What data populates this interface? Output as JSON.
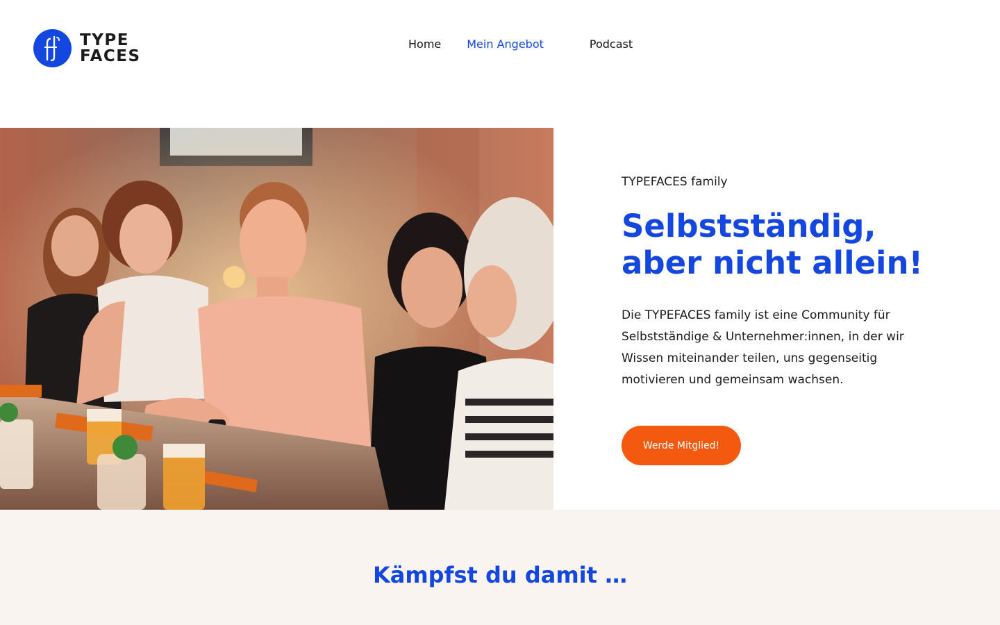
{
  "header": {
    "logo": {
      "line1": "TYPE",
      "line2": "FACES"
    },
    "nav": {
      "home": "Home",
      "angebot": "Mein Angebot",
      "angebot_caret": "",
      "podcast_icon": "",
      "podcast": "Podcast"
    }
  },
  "hero": {
    "image_alt": "Gruppe von Menschen an einem Tisch in einer Bar",
    "eyebrow": "TYPEFACES family",
    "title_line1": "Selbstständig,",
    "title_line2": "aber nicht allein!",
    "text_line1": "Die TYPEFACES family ist eine Community für",
    "text_line2": "Selbstständige & Unternehmer:innen, in der wir",
    "text_line3": "Wissen miteinander teilen, uns gegenseitig",
    "text_line4": "motivieren und gemeinsam wachsen.",
    "cta": "Werde Mitglied!"
  },
  "section2": {
    "title": "Kämpfst du damit …"
  },
  "colors": {
    "brand_blue": "#1447e0",
    "accent_orange": "#f35a0f",
    "section_bg": "#f9f4ef"
  },
  "icons": {
    "logo": "typefaces-logo-icon",
    "dropdown": "chevron-down-icon",
    "podcast": "microphone-icon"
  }
}
